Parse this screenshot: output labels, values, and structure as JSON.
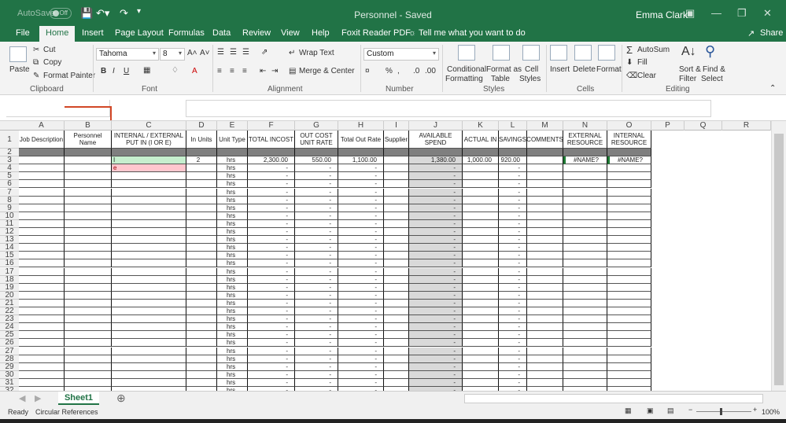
{
  "titlebar": {
    "autosave_label": "AutoSave",
    "autosave_state": "Off",
    "title": "Personnel  -  Saved",
    "user": "Emma Clark"
  },
  "tabs": [
    "File",
    "Home",
    "Insert",
    "Page Layout",
    "Formulas",
    "Data",
    "Review",
    "View",
    "Help",
    "Foxit Reader PDF"
  ],
  "tell_me": "Tell me what you want to do",
  "share": "Share",
  "ribbon": {
    "clipboard": {
      "paste": "Paste",
      "cut": "Cut",
      "copy": "Copy",
      "format_painter": "Format Painter",
      "label": "Clipboard"
    },
    "font": {
      "name": "Tahoma",
      "size": "8",
      "label": "Font"
    },
    "alignment": {
      "wrap": "Wrap Text",
      "merge": "Merge & Center",
      "label": "Alignment"
    },
    "number": {
      "format": "Custom",
      "label": "Number"
    },
    "styles": {
      "conditional": "Conditional",
      "formatting": "Formatting",
      "format_as": "Format as",
      "table": "Table",
      "cell": "Cell",
      "cell_styles": "Styles",
      "label": "Styles"
    },
    "cells": {
      "insert": "Insert",
      "delete": "Delete",
      "format": "Format",
      "label": "Cells"
    },
    "editing": {
      "autosum": "AutoSum",
      "fill": "Fill",
      "clear": "Clear",
      "sort": "Sort &",
      "filter": "Filter",
      "find": "Find &",
      "select": "Select",
      "label": "Editing"
    }
  },
  "columns": [
    "A",
    "B",
    "C",
    "D",
    "E",
    "F",
    "G",
    "H",
    "I",
    "J",
    "K",
    "L",
    "M",
    "N",
    "O",
    "P",
    "Q",
    "R"
  ],
  "headers": [
    "Job Description",
    "Personnel Name",
    "INTERNAL  / EXTERNAL PUT IN (I OR E)",
    "In Units",
    "Unit Type",
    "TOTAL INCOST",
    "OUT COST UNIT RATE",
    "Total Out Rate",
    "Supplier",
    "AVAILABLE SPEND",
    "ACTUAL IN",
    "SAVINGS",
    "COMMENTS",
    "EXTERNAL RESOURCE",
    "INTERNAL RESOURCE"
  ],
  "row3": {
    "C": "I",
    "D": "2",
    "E": "hrs",
    "F": "2,300.00",
    "G": "550.00",
    "H": "1,100.00",
    "J": "1,380.00",
    "K": "1,000.00",
    "L": "920.00",
    "N": "#NAME?",
    "O": "#NAME?"
  },
  "row4_C": "e",
  "unit_default": "hrs",
  "dash": "-",
  "sheet_name": "Sheet1",
  "status": {
    "ready": "Ready",
    "circular": "Circular References",
    "zoom": "100%"
  }
}
